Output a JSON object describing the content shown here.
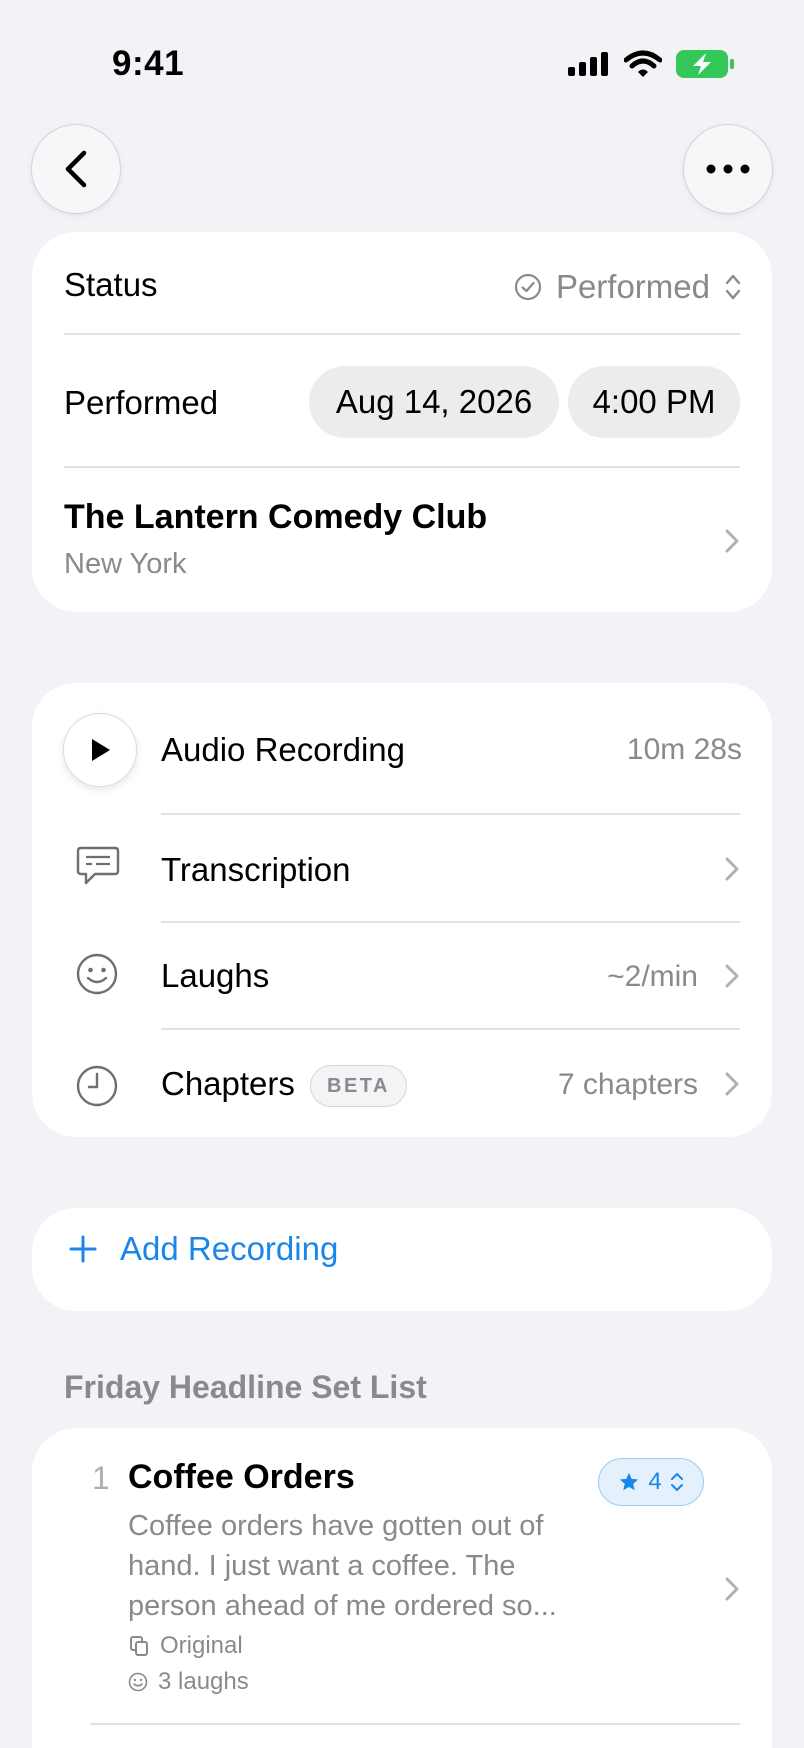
{
  "status_bar": {
    "time": "9:41"
  },
  "details": {
    "status_label": "Status",
    "status_value": "Performed",
    "performed_label": "Performed",
    "date": "Aug 14, 2026",
    "time": "4:00 PM",
    "venue_name": "The Lantern Comedy Club",
    "venue_city": "New York"
  },
  "recording": {
    "audio_label": "Audio Recording",
    "audio_duration": "10m 28s",
    "transcription_label": "Transcription",
    "laughs_label": "Laughs",
    "laughs_value": "~2/min",
    "chapters_label": "Chapters",
    "chapters_badge": "BETA",
    "chapters_value": "7 chapters"
  },
  "add_recording": {
    "label": "Add Recording"
  },
  "set_list": {
    "title": "Friday Headline Set List",
    "items": [
      {
        "number": "1",
        "title": "Coffee Orders",
        "excerpt": "Coffee orders have gotten out of hand. I just want a coffee. The person ahead of me ordered so...",
        "version": "Original",
        "laughs": "3 laughs",
        "rating": "4"
      }
    ]
  },
  "colors": {
    "accent": "#1a87e8",
    "background": "#f2f2f7",
    "secondary_text": "#8a8a8e"
  },
  "icons": [
    "chevron-left-icon",
    "ellipsis-icon",
    "check-circle-icon",
    "updown-chevron-icon",
    "play-icon",
    "message-icon",
    "smiley-icon",
    "clock-icon",
    "plus-icon",
    "star-icon",
    "copy-icon"
  ]
}
